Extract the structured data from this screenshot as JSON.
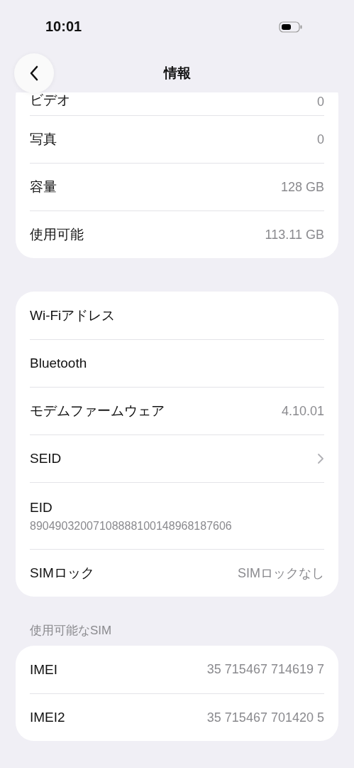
{
  "status_bar": {
    "time": "10:01"
  },
  "nav": {
    "title": "情報"
  },
  "groups": [
    {
      "rows": [
        {
          "kind": "value",
          "label": "ビデオ",
          "value": "0"
        },
        {
          "kind": "value",
          "label": "写真",
          "value": "0"
        },
        {
          "kind": "value",
          "label": "容量",
          "value": "128 GB"
        },
        {
          "kind": "value",
          "label": "使用可能",
          "value": "113.11 GB"
        }
      ]
    },
    {
      "rows": [
        {
          "kind": "value",
          "label": "Wi-Fiアドレス"
        },
        {
          "kind": "value",
          "label": "Bluetooth"
        },
        {
          "kind": "value",
          "label": "モデムファームウェア",
          "value": "4.10.01"
        },
        {
          "kind": "chevron",
          "label": "SEID"
        },
        {
          "kind": "stacked",
          "label": "EID",
          "value": "89049032007108888100148968187606"
        },
        {
          "kind": "value",
          "label": "SIMロック",
          "value": "SIMロックなし"
        }
      ]
    },
    {
      "header": "使用可能なSIM",
      "rows": [
        {
          "kind": "value",
          "label": "IMEI",
          "value": "35 715467 714619 7"
        },
        {
          "kind": "value",
          "label": "IMEI2",
          "value": "35 715467 701420 5"
        }
      ]
    }
  ]
}
